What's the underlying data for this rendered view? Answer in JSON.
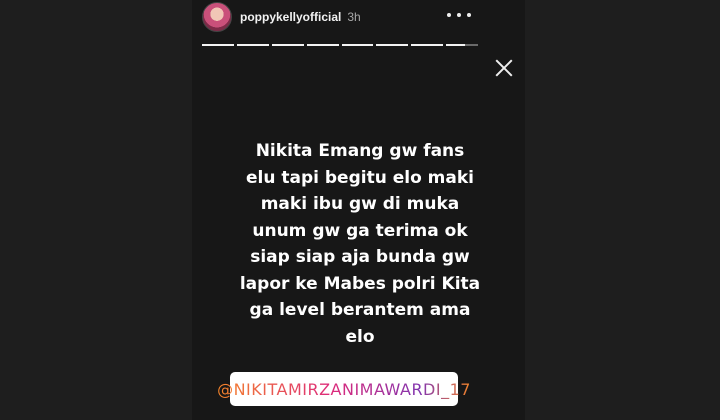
{
  "story": {
    "username": "poppykellyofficial",
    "time_ago": "3h",
    "progress_segments": 8,
    "progress_partial_fraction": 0.6,
    "text_lines": [
      "Nikita Emang gw fans",
      "elu tapi begitu elo maki",
      "maki ibu gw di muka",
      "unum gw ga terima ok",
      "siap siap aja bunda gw",
      "lapor ke Mabes polri Kita",
      "ga level berantem ama",
      "elo"
    ],
    "mention": "@NIKITAMIRZANIMAWARDI_17"
  },
  "icons": {
    "more": "more-horizontal-icon",
    "close": "close-icon"
  },
  "colors": {
    "background": "#1f1f1f",
    "story_background": "#171717",
    "text": "#ffffff"
  }
}
